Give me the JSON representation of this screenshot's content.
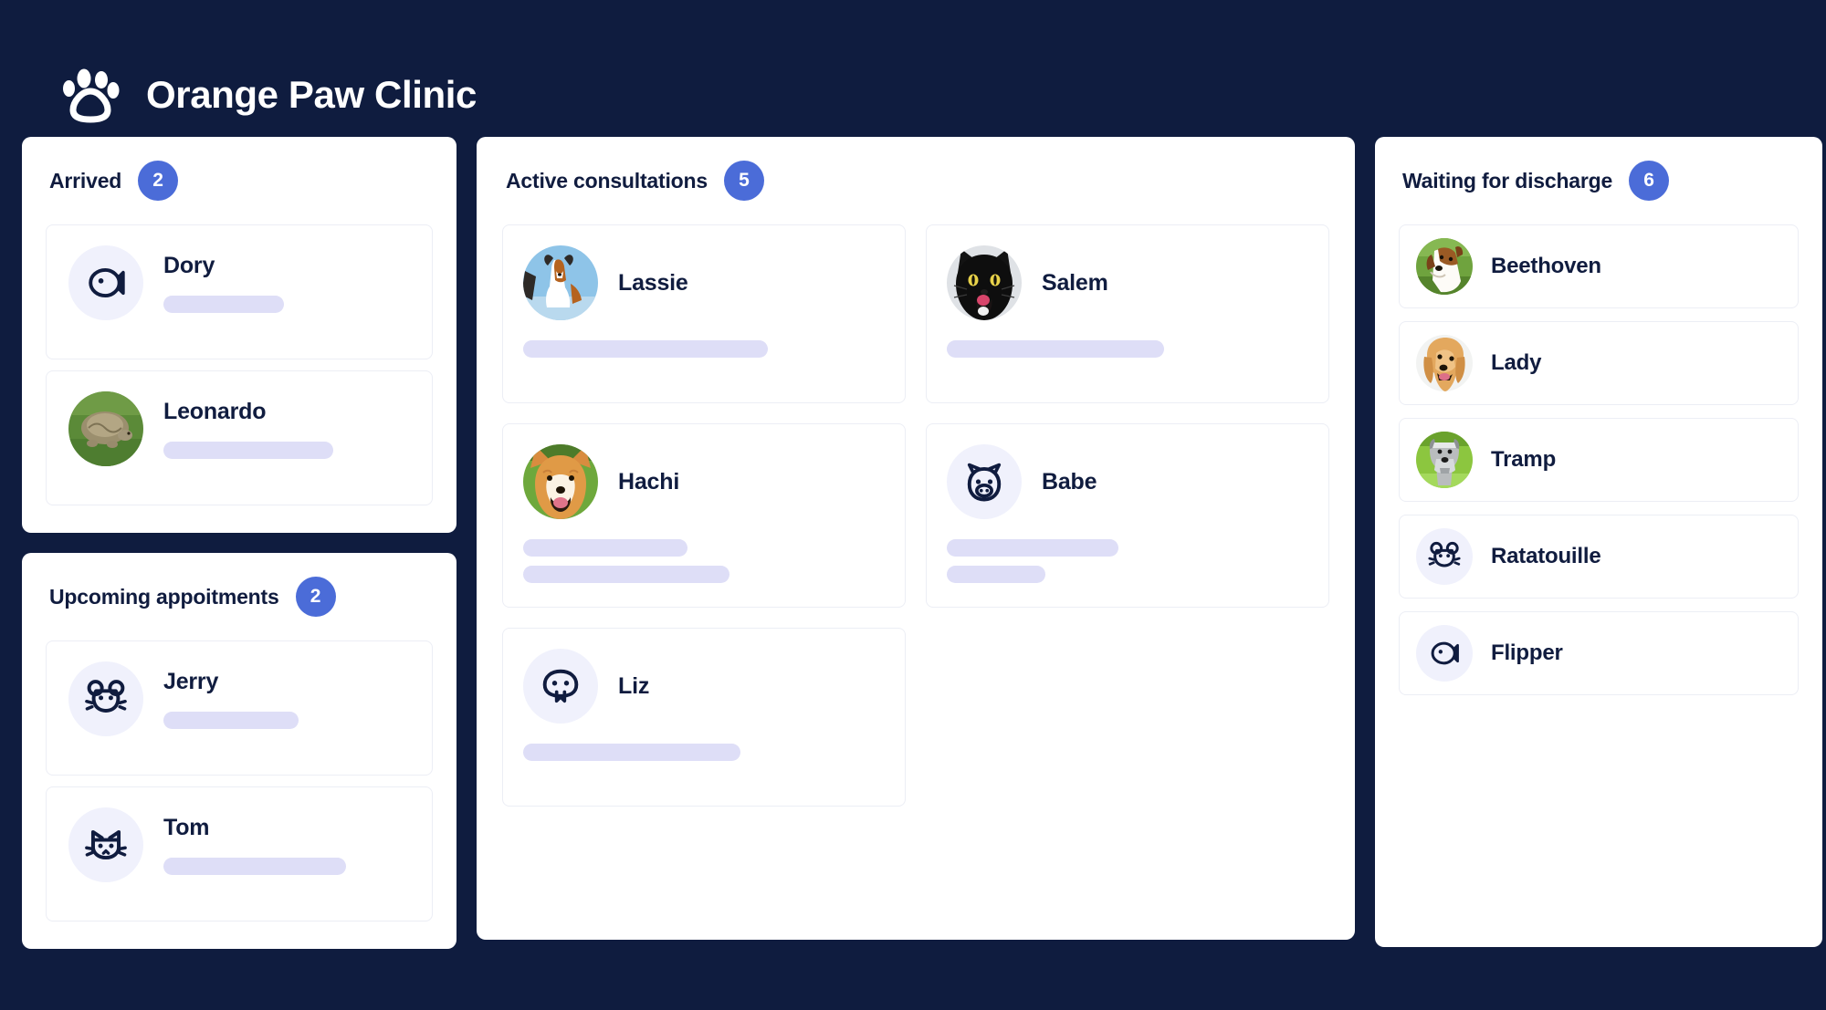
{
  "app": {
    "title": "Orange Paw Clinic",
    "logo_icon": "paw-icon",
    "background_color": "#0f1c3f",
    "accent_color": "#4b6cd8",
    "text_color": "#101c3f",
    "placeholder_color": "#dedef7",
    "icon_bubble_color": "#f0f1fc"
  },
  "columns": {
    "arrived": {
      "title": "Arrived",
      "count": "2",
      "patients": [
        {
          "name": "Dory",
          "avatar_type": "icon",
          "icon": "fish-icon",
          "bars": [
            1
          ]
        },
        {
          "name": "Leonardo",
          "avatar_type": "photo",
          "photo": "tortoise-photo",
          "bars": [
            1
          ]
        }
      ]
    },
    "upcoming": {
      "title": "Upcoming appoitments",
      "count": "2",
      "patients": [
        {
          "name": "Jerry",
          "avatar_type": "icon",
          "icon": "mouse-icon",
          "bars": [
            1
          ]
        },
        {
          "name": "Tom",
          "avatar_type": "icon",
          "icon": "cat-icon",
          "bars": [
            1
          ]
        }
      ]
    },
    "active": {
      "title": "Active consultations",
      "count": "5",
      "patients": [
        {
          "name": "Lassie",
          "avatar_type": "photo",
          "photo": "collie-dog-photo",
          "bars": [
            1
          ]
        },
        {
          "name": "Salem",
          "avatar_type": "photo",
          "photo": "black-cat-photo",
          "bars": [
            1
          ]
        },
        {
          "name": "Hachi",
          "avatar_type": "photo",
          "photo": "shiba-dog-photo",
          "bars": [
            1,
            2
          ]
        },
        {
          "name": "Babe",
          "avatar_type": "icon",
          "icon": "pig-icon",
          "bars": [
            1,
            2
          ]
        },
        {
          "name": "Liz",
          "avatar_type": "icon",
          "icon": "lizard-icon",
          "bars": [
            1
          ]
        }
      ]
    },
    "discharge": {
      "title": "Waiting for discharge",
      "count": "6",
      "patients": [
        {
          "name": "Beethoven",
          "avatar_type": "photo",
          "photo": "stbernard-dog-photo"
        },
        {
          "name": "Lady",
          "avatar_type": "photo",
          "photo": "cocker-spaniel-photo"
        },
        {
          "name": "Tramp",
          "avatar_type": "photo",
          "photo": "schnauzer-dog-photo"
        },
        {
          "name": "Ratatouille",
          "avatar_type": "icon",
          "icon": "rat-icon"
        },
        {
          "name": "Flipper",
          "avatar_type": "icon",
          "icon": "fish-icon"
        }
      ]
    }
  }
}
